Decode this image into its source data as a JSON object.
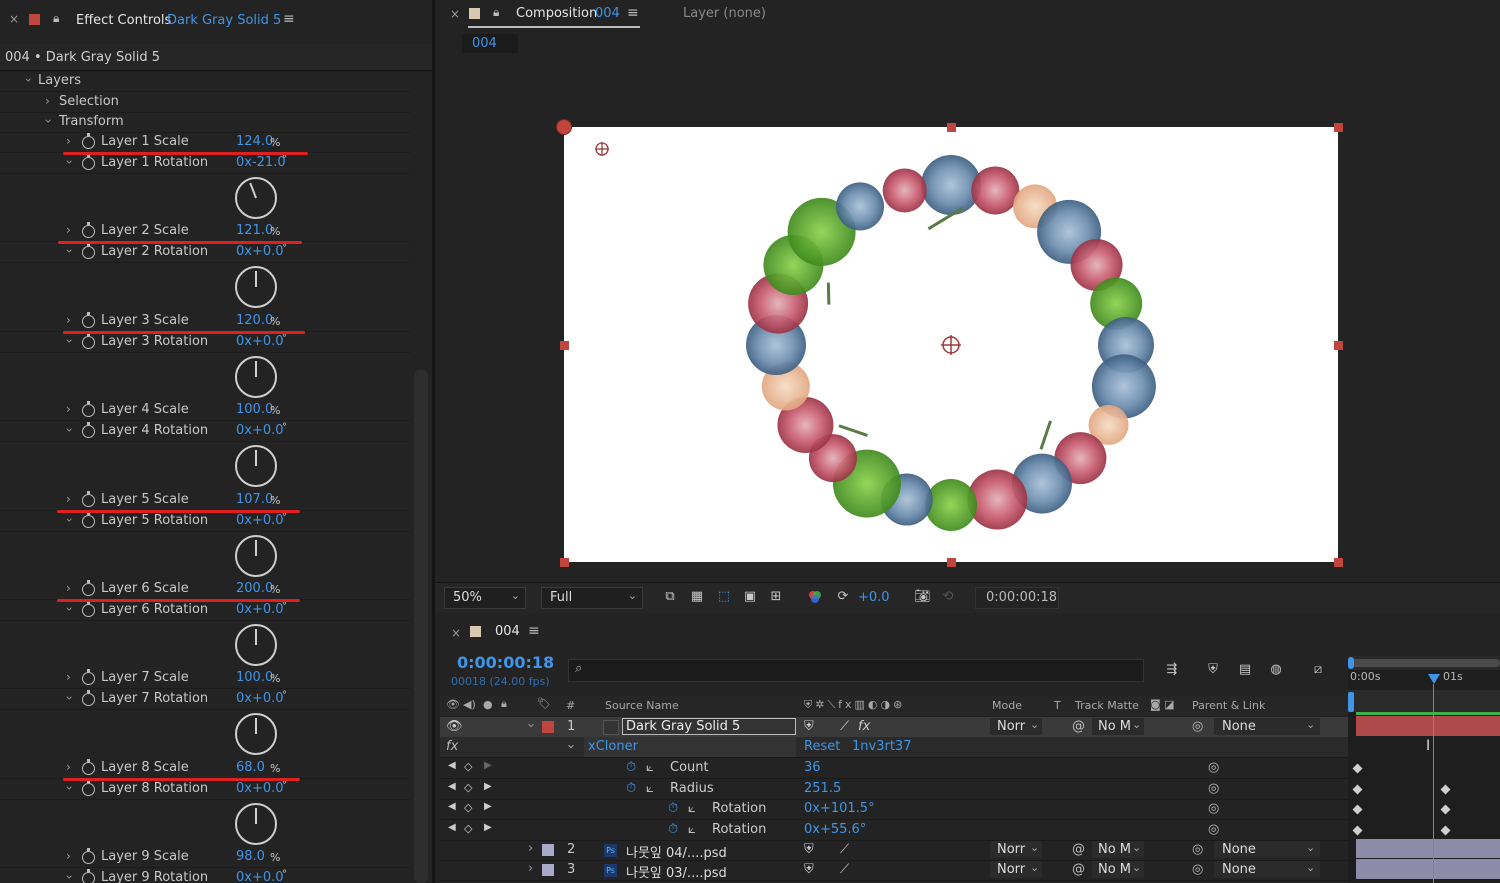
{
  "effect_controls": {
    "title": "Effect Controls",
    "layer_name": "Dark Gray Solid 5",
    "subtitle": "004 • Dark Gray Solid 5",
    "groups": {
      "layers": "Layers",
      "selection": "Selection",
      "transform": "Transform"
    },
    "params": [
      {
        "scale_label": "Layer 1 Scale",
        "scale_value": "124.0",
        "rot_label": "Layer 1 Rotation",
        "rot_value": "0x-21.0"
      },
      {
        "scale_label": "Layer 2 Scale",
        "scale_value": "121.0",
        "rot_label": "Layer 2 Rotation",
        "rot_value": "0x+0.0"
      },
      {
        "scale_label": "Layer 3 Scale",
        "scale_value": "120.0",
        "rot_label": "Layer 3 Rotation",
        "rot_value": "0x+0.0"
      },
      {
        "scale_label": "Layer 4 Scale",
        "scale_value": "100.0",
        "rot_label": "Layer 4 Rotation",
        "rot_value": "0x+0.0"
      },
      {
        "scale_label": "Layer 5 Scale",
        "scale_value": "107.0",
        "rot_label": "Layer 5 Rotation",
        "rot_value": "0x+0.0"
      },
      {
        "scale_label": "Layer 6 Scale",
        "scale_value": "200.0",
        "rot_label": "Layer 6 Rotation",
        "rot_value": "0x+0.0"
      },
      {
        "scale_label": "Layer 7 Scale",
        "scale_value": "100.0",
        "rot_label": "Layer 7 Rotation",
        "rot_value": "0x+0.0"
      },
      {
        "scale_label": "Layer 8 Scale",
        "scale_value": "68.0",
        "rot_label": "Layer 8 Rotation",
        "rot_value": "0x+0.0"
      },
      {
        "scale_label": "Layer 9 Scale",
        "scale_value": "98.0",
        "rot_label": "Layer 9 Rotation",
        "rot_value": "0x+0.0"
      }
    ],
    "percent_unit": "%",
    "degree_unit": "°"
  },
  "composition": {
    "tab_label": "Composition",
    "comp_name": "004",
    "layer_tab": "Layer (none)",
    "breadcrumb": "004",
    "toolbar": {
      "zoom": "50%",
      "resolution": "Full",
      "exposure": "+0.0",
      "timecode": "0:00:00:18"
    }
  },
  "timeline": {
    "tab_label": "004",
    "current_time": "0:00:00:18",
    "frame_info": "00018 (24.00 fps)",
    "search_placeholder": "",
    "columns": {
      "num": "#",
      "source": "Source Name",
      "mode": "Mode",
      "t": "T",
      "trackmatte": "Track Matte",
      "parent": "Parent & Link"
    },
    "ruler": [
      "0:00s",
      "01s"
    ],
    "layers": [
      {
        "num": "1",
        "name": "Dark Gray Solid 5",
        "mode": "Norr",
        "matte": "No M",
        "parent": "None"
      },
      {
        "num": "2",
        "name": "나뭇잎 04/....psd",
        "mode": "Norr",
        "matte": "No M",
        "parent": "None"
      },
      {
        "num": "3",
        "name": "나뭇잎 03/....psd",
        "mode": "Norr",
        "matte": "No M",
        "parent": "None"
      }
    ],
    "effect": {
      "name": "xCloner",
      "reset": "Reset",
      "about": "1nv3rt37"
    },
    "props": [
      {
        "label": "Count",
        "value": "36"
      },
      {
        "label": "Radius",
        "value": "251.5"
      },
      {
        "label": "Rotation",
        "value": "0x+101.5°"
      },
      {
        "label": "Rotation",
        "value": "0x+55.6°"
      }
    ]
  },
  "rotations_deg": [
    -21,
    0,
    0,
    0,
    0,
    0,
    0,
    0,
    0
  ],
  "colors": {
    "accent_blue": "#3f95e8",
    "annotation_red": "#e02020",
    "label_red": "#c0453c"
  }
}
